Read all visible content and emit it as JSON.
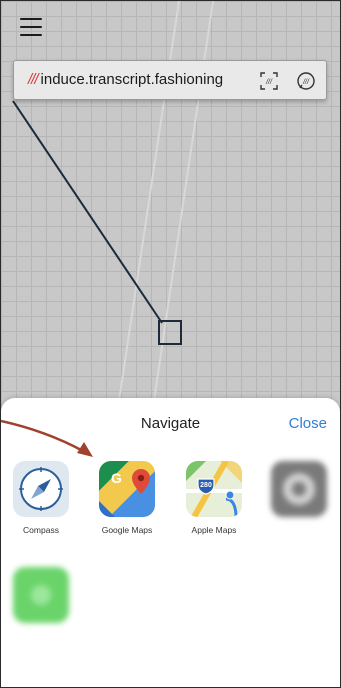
{
  "address_bar": {
    "prefix": "///",
    "words": "induce.transcript.fashioning"
  },
  "sheet": {
    "title": "Navigate",
    "close_label": "Close"
  },
  "apps": [
    {
      "name": "Compass",
      "icon": "compass-icon"
    },
    {
      "name": "Google Maps",
      "icon": "google-maps-icon"
    },
    {
      "name": "Apple Maps",
      "icon": "apple-maps-icon"
    },
    {
      "name": "",
      "icon": "blurred-app-icon"
    },
    {
      "name": "",
      "icon": "blurred-green-app-icon"
    }
  ],
  "apple_maps_badge": "280",
  "colors": {
    "slashes": "#d43b3b",
    "close": "#2f7fd2",
    "arrow": "#a0422e"
  }
}
